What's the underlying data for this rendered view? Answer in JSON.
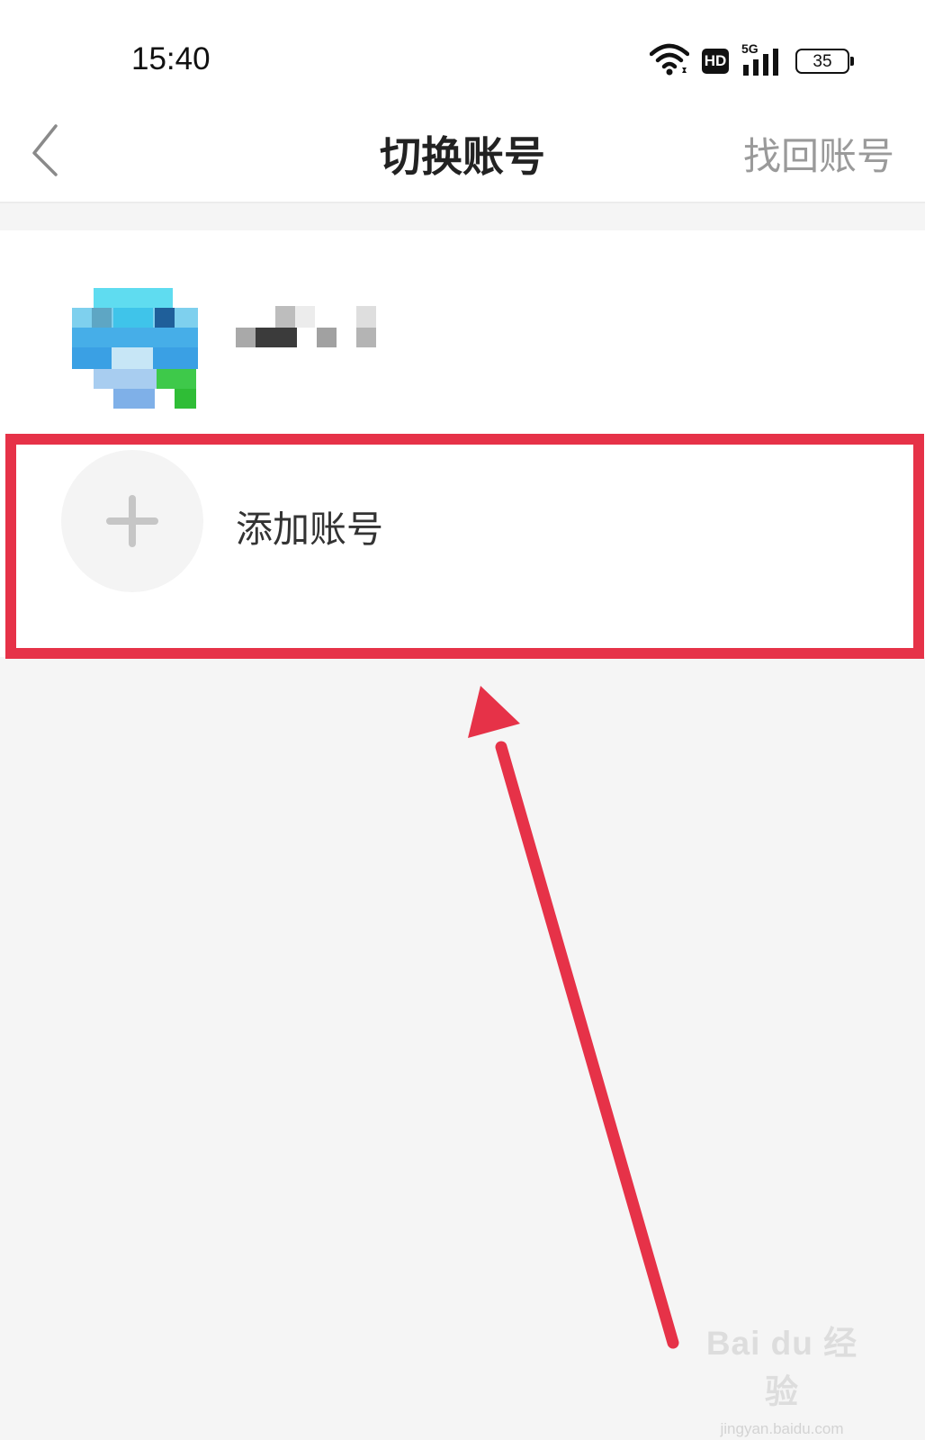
{
  "status_bar": {
    "time": "15:40",
    "network_label": "5G",
    "hd_label": "HD",
    "battery_level": "35",
    "icons": [
      "wifi-icon",
      "hd-icon",
      "signal-icon",
      "battery-icon"
    ]
  },
  "nav": {
    "title": "切换账号",
    "right_action": "找回账号",
    "back_icon": "chevron-left-icon"
  },
  "accounts": [
    {
      "name": "",
      "avatar_icon": "pixelated-avatar"
    }
  ],
  "add_account": {
    "label": "添加账号",
    "icon": "plus-icon"
  },
  "annotation": {
    "highlight_color": "#e63248",
    "arrow_icon": "red-arrow-icon"
  },
  "watermark": {
    "logo": "Bai du 经验",
    "url": "jingyan.baidu.com"
  }
}
